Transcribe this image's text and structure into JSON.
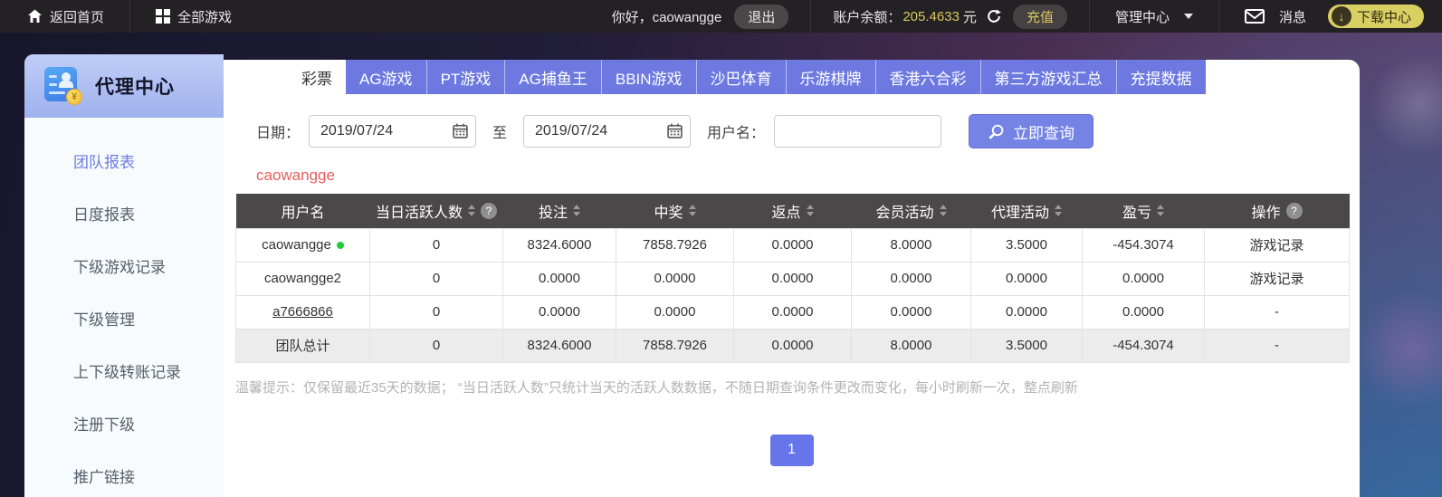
{
  "topbar": {
    "home": "返回首页",
    "all_games": "全部游戏",
    "greeting": "你好，caowangge",
    "logout": "退出",
    "balance_label": "账户余额：",
    "balance_value": "205.4633",
    "balance_unit": "元",
    "recharge": "充值",
    "admin_center": "管理中心",
    "messages": "消息",
    "download_center": "下载中心"
  },
  "sidebar": {
    "title": "代理中心",
    "items": [
      {
        "label": "团队报表",
        "active": true
      },
      {
        "label": "日度报表",
        "active": false
      },
      {
        "label": "下级游戏记录",
        "active": false
      },
      {
        "label": "下级管理",
        "active": false
      },
      {
        "label": "上下级转账记录",
        "active": false
      },
      {
        "label": "注册下级",
        "active": false
      },
      {
        "label": "推广链接",
        "active": false
      }
    ]
  },
  "tabs": [
    {
      "label": "彩票",
      "active": true
    },
    {
      "label": "AG游戏",
      "active": false
    },
    {
      "label": "PT游戏",
      "active": false
    },
    {
      "label": "AG捕鱼王",
      "active": false
    },
    {
      "label": "BBIN游戏",
      "active": false
    },
    {
      "label": "沙巴体育",
      "active": false
    },
    {
      "label": "乐游棋牌",
      "active": false
    },
    {
      "label": "香港六合彩",
      "active": false
    },
    {
      "label": "第三方游戏汇总",
      "active": false
    },
    {
      "label": "充提数据",
      "active": false
    }
  ],
  "filter": {
    "date_label": "日期：",
    "date_from": "2019/07/24",
    "to_label": "至",
    "date_to": "2019/07/24",
    "username_label": "用户名：",
    "username_value": "",
    "search_button": "立即查询"
  },
  "report": {
    "agent_name": "caowangge",
    "headers": {
      "username": "用户名",
      "active_count": "当日活跃人数",
      "bet": "投注",
      "win": "中奖",
      "rebate": "返点",
      "member_activity": "会员活动",
      "agent_activity": "代理活动",
      "profit": "盈亏",
      "action": "操作"
    },
    "rows": [
      {
        "username": "caowangge",
        "online": true,
        "active_count": "0",
        "bet": "8324.6000",
        "win": "7858.7926",
        "rebate": "0.0000",
        "member_activity": "8.0000",
        "agent_activity": "3.5000",
        "profit": "-454.3074",
        "action": "游戏记录"
      },
      {
        "username": "caowangge2",
        "online": false,
        "active_count": "0",
        "bet": "0.0000",
        "win": "0.0000",
        "rebate": "0.0000",
        "member_activity": "0.0000",
        "agent_activity": "0.0000",
        "profit": "0.0000",
        "action": "游戏记录"
      },
      {
        "username": "a7666866",
        "online": false,
        "active_count": "0",
        "bet": "0.0000",
        "win": "0.0000",
        "rebate": "0.0000",
        "member_activity": "0.0000",
        "agent_activity": "0.0000",
        "profit": "0.0000",
        "action": "-"
      },
      {
        "username": "团队总计",
        "online": false,
        "active_count": "0",
        "bet": "8324.6000",
        "win": "7858.7926",
        "rebate": "0.0000",
        "member_activity": "8.0000",
        "agent_activity": "3.5000",
        "profit": "-454.3074",
        "action": "-"
      }
    ],
    "note": "温馨提示：仅保留最近35天的数据； “当日活跃人数”只统计当天的活跃人数数据，不随日期查询条件更改而变化，每小时刷新一次，整点刷新",
    "pagination": {
      "current_page": "1"
    }
  },
  "colors": {
    "accent_purple": "#6d79e0",
    "highlight_red": "#e95d5d",
    "balance_yellow": "#d9c75e",
    "online_green": "#21cc37",
    "table_header": "#4a4848"
  }
}
